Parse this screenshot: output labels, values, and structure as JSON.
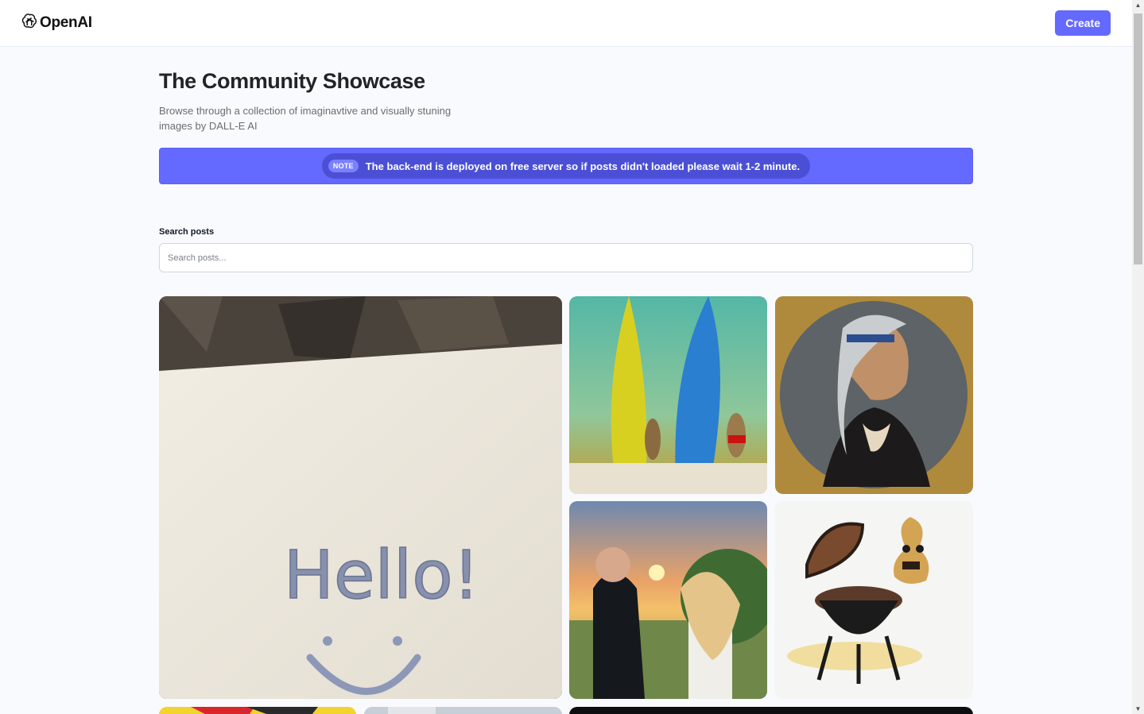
{
  "header": {
    "logo_text": "OpenAI",
    "create_label": "Create"
  },
  "main": {
    "title": "The Community Showcase",
    "subtitle": "Browse through a collection of imaginavtive and visually stuning images by DALL-E AI",
    "note": {
      "badge": "NOTE",
      "text": "The back-end is deployed on free server so if posts didn't loaded please wait 1-2 minute."
    },
    "search": {
      "label": "Search posts",
      "placeholder": "Search posts..."
    }
  },
  "gallery": {
    "hello_text": "Hello!"
  },
  "colors": {
    "accent": "#6469ff",
    "background": "#f9fafe",
    "title": "#222328",
    "subtitle": "#666e75"
  },
  "icons": [
    "openai-logo-icon"
  ]
}
